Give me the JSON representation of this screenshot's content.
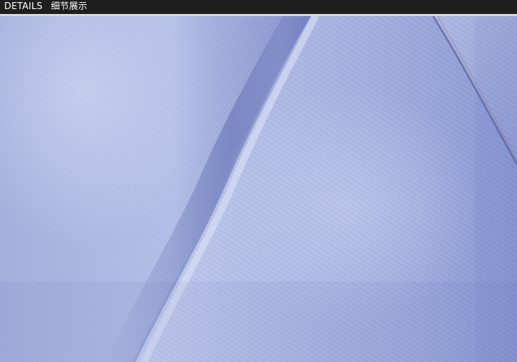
{
  "header": {
    "title_en": "DETAILS",
    "title_zh": "细节展示"
  },
  "image": {
    "subject": "fabric-detail",
    "colors": {
      "base": "#a6b4de",
      "highlight": "#c9d3ef",
      "shadow": "#7f8dca",
      "deep_shadow": "#6a77b8",
      "header_bg": "#1e1e1e",
      "divider": "#d9d9d9"
    }
  }
}
